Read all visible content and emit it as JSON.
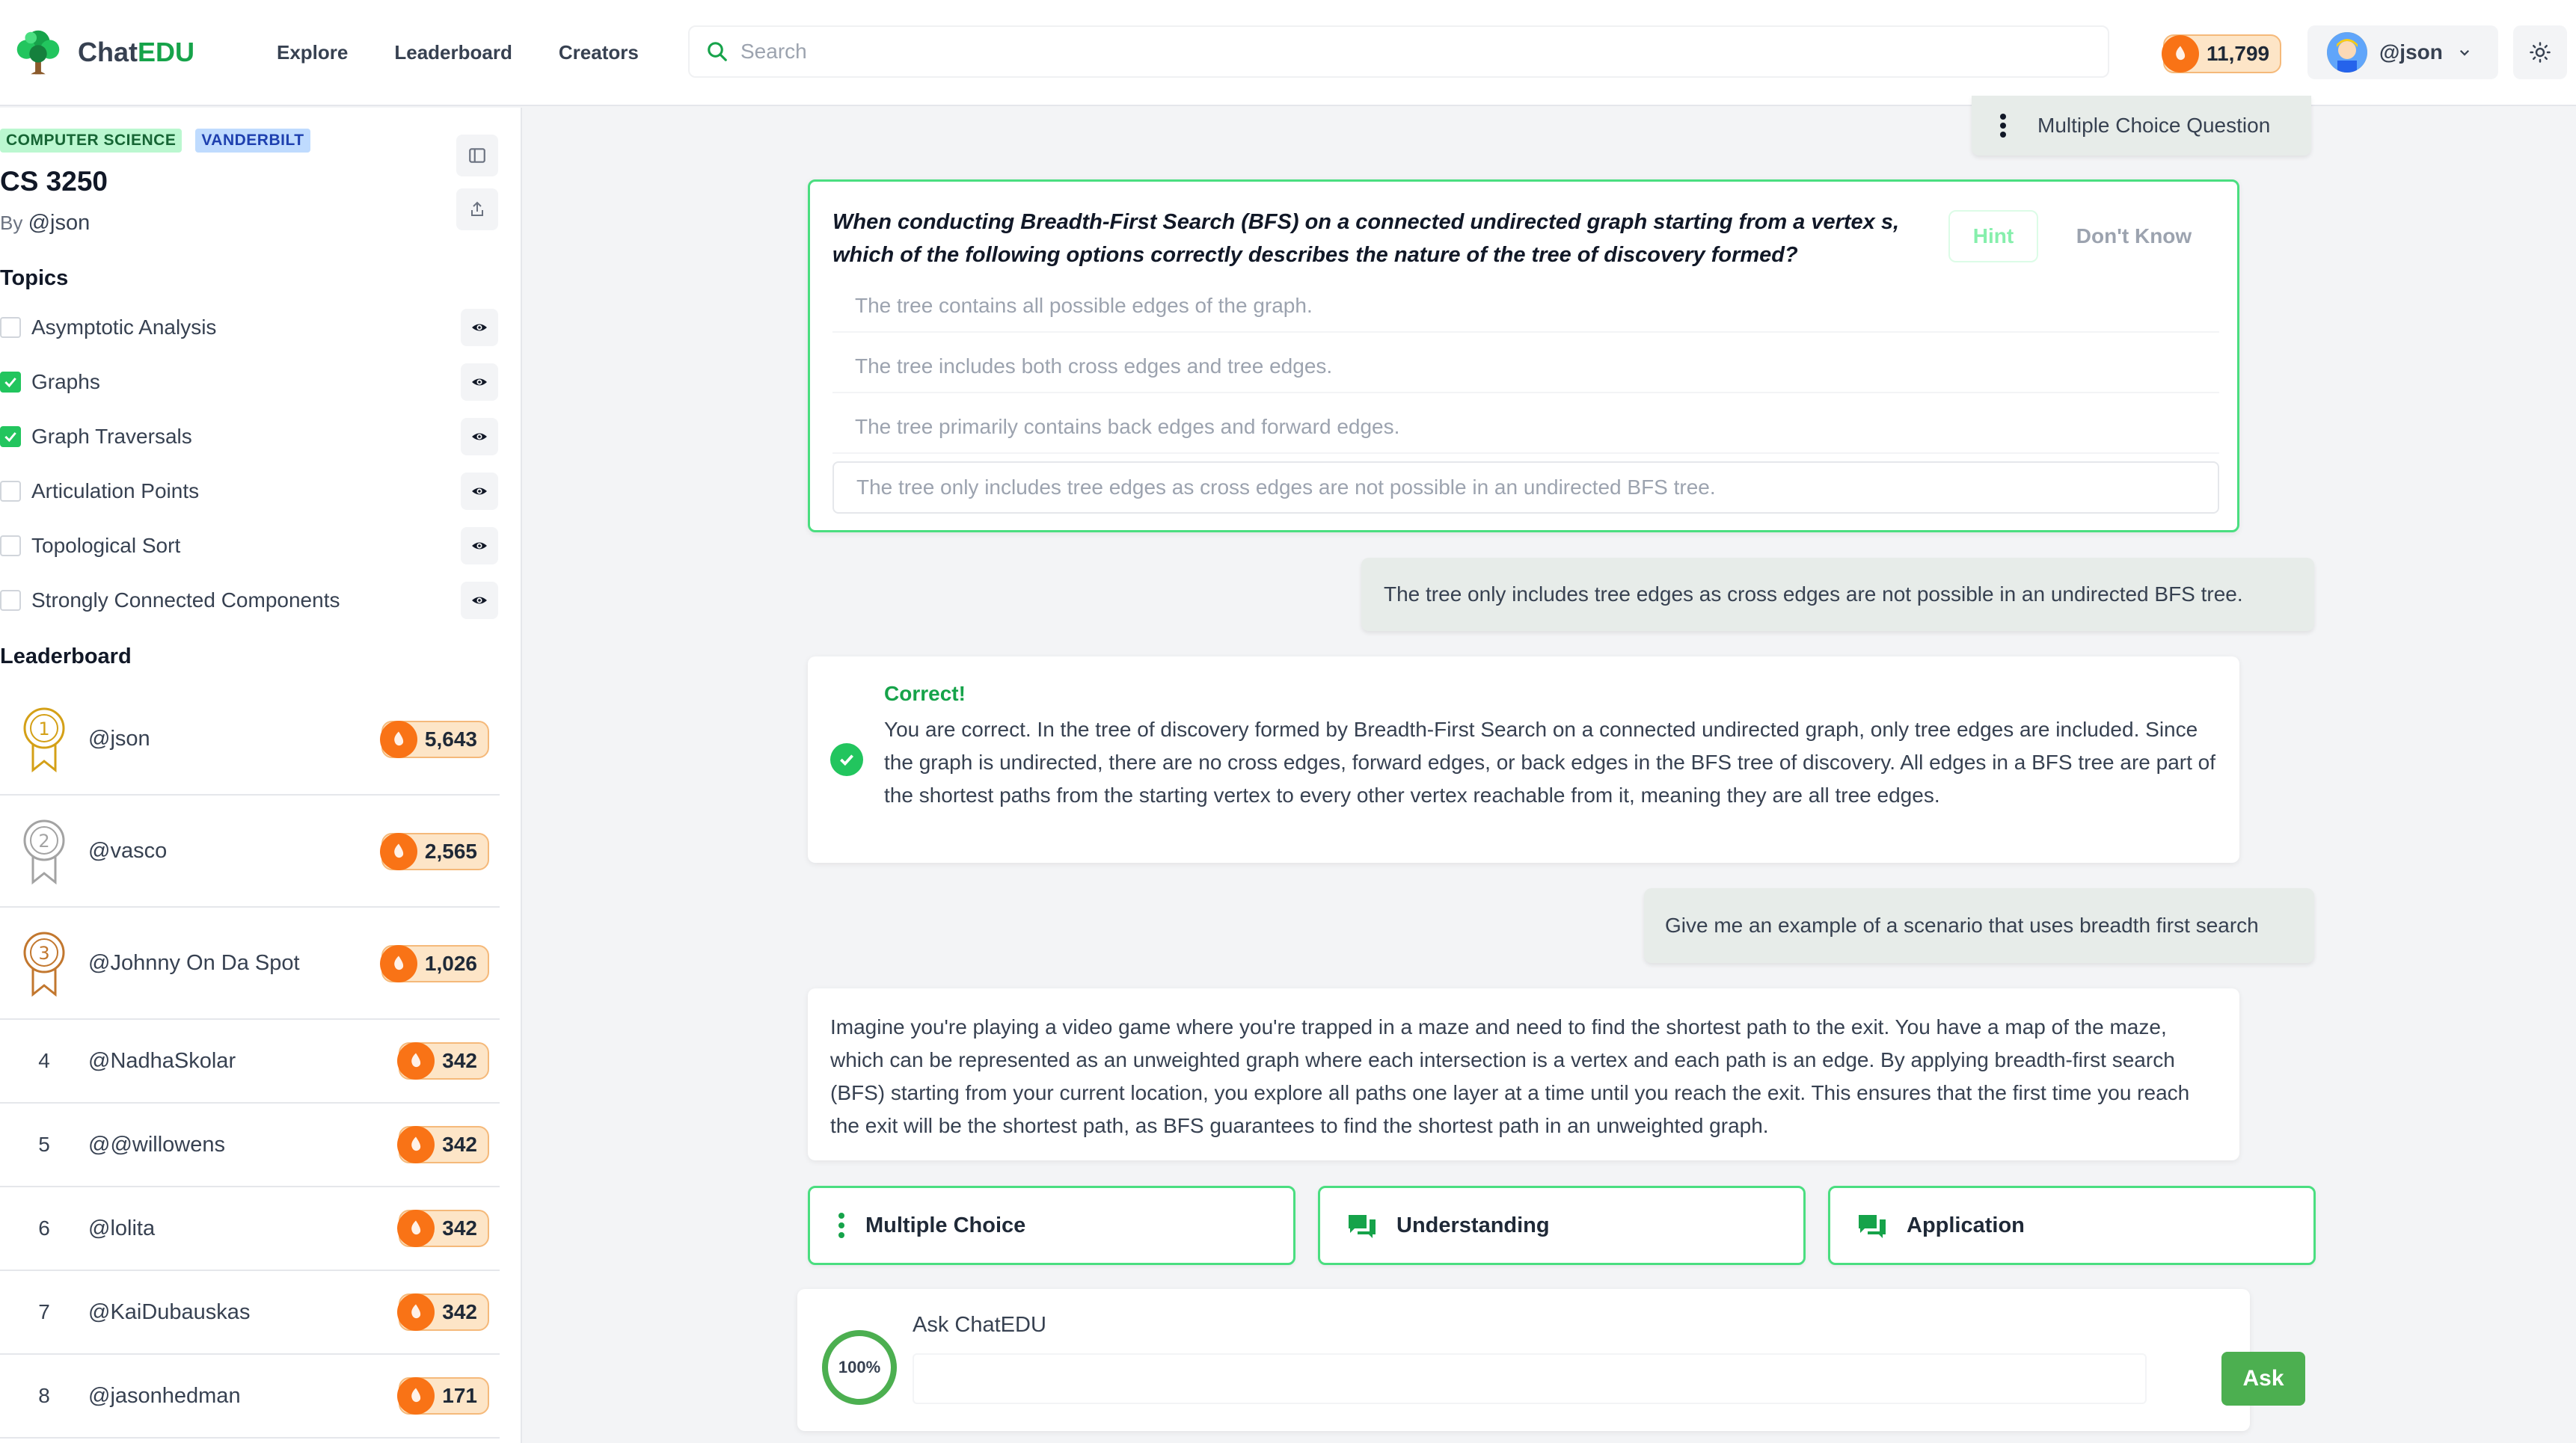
{
  "header": {
    "brand_prefix": "Chat",
    "brand_suffix": "EDU",
    "nav": [
      "Explore",
      "Leaderboard",
      "Creators"
    ],
    "search_placeholder": "Search",
    "coins": "11,799",
    "user": "@json"
  },
  "sidebar": {
    "tags": [
      "COMPUTER SCIENCE",
      "VANDERBILT"
    ],
    "course_title": "CS 3250",
    "by_prefix": "By",
    "author": "@json",
    "topics_heading": "Topics",
    "topics": [
      {
        "label": "Asymptotic Analysis",
        "checked": false
      },
      {
        "label": "Graphs",
        "checked": true
      },
      {
        "label": "Graph Traversals",
        "checked": true
      },
      {
        "label": "Articulation Points",
        "checked": false
      },
      {
        "label": "Topological Sort",
        "checked": false
      },
      {
        "label": "Strongly Connected Components",
        "checked": false
      }
    ],
    "leaderboard_heading": "Leaderboard",
    "leaderboard": [
      {
        "rank": "1",
        "name": "@json",
        "coins": "5,643"
      },
      {
        "rank": "2",
        "name": "@vasco",
        "coins": "2,565"
      },
      {
        "rank": "3",
        "name": "@Johnny On Da Spot",
        "coins": "1,026"
      },
      {
        "rank": "4",
        "name": "@NadhaSkolar",
        "coins": "342"
      },
      {
        "rank": "5",
        "name": "@@willowens",
        "coins": "342"
      },
      {
        "rank": "6",
        "name": "@lolita",
        "coins": "342"
      },
      {
        "rank": "7",
        "name": "@KaiDubauskas",
        "coins": "342"
      },
      {
        "rank": "8",
        "name": "@jasonhedman",
        "coins": "171"
      }
    ]
  },
  "chat": {
    "mcq_tag": "Multiple Choice Question",
    "question": "When conducting Breadth-First Search (BFS) on a connected undirected graph starting from a vertex s, which of the following options correctly describes the nature of the tree of discovery formed?",
    "hint_label": "Hint",
    "dont_know_label": "Don't Know",
    "options": [
      "The tree contains all possible edges of the graph.",
      "The tree includes both cross edges and tree edges.",
      "The tree primarily contains back edges and forward edges.",
      "The tree only includes tree edges as cross edges are not possible in an undirected BFS tree."
    ],
    "user_answer": "The tree only includes tree edges as cross edges are not possible in an undirected BFS tree.",
    "correct_title": "Correct!",
    "correct_body": "You are correct. In the tree of discovery formed by Breadth-First Search on a connected undirected graph, only tree edges are included. Since the graph is undirected, there are no cross edges, forward edges, or back edges in the BFS tree of discovery. All edges in a BFS tree are part of the shortest paths from the starting vertex to every other vertex reachable from it, meaning they are all tree edges.",
    "user_question": "Give me an example of a scenario that uses breadth first search",
    "answer": "Imagine you're playing a video game where you're trapped in a maze and need to find the shortest path to the exit. You have a map of the maze, which can be represented as an unweighted graph where each intersection is a vertex and each path is an edge. By applying breadth-first search (BFS) starting from your current location, you explore all paths one layer at a time until you reach the exit. This ensures that the first time you reach the exit will be the shortest path, as BFS guarantees to find the shortest path in an unweighted graph.",
    "suggestions": [
      "Multiple Choice",
      "Understanding",
      "Application"
    ]
  },
  "ask": {
    "progress": "100%",
    "label": "Ask ChatEDU",
    "button": "Ask"
  },
  "colors": {
    "accent": "#22c55e",
    "coin": "#f97316"
  }
}
